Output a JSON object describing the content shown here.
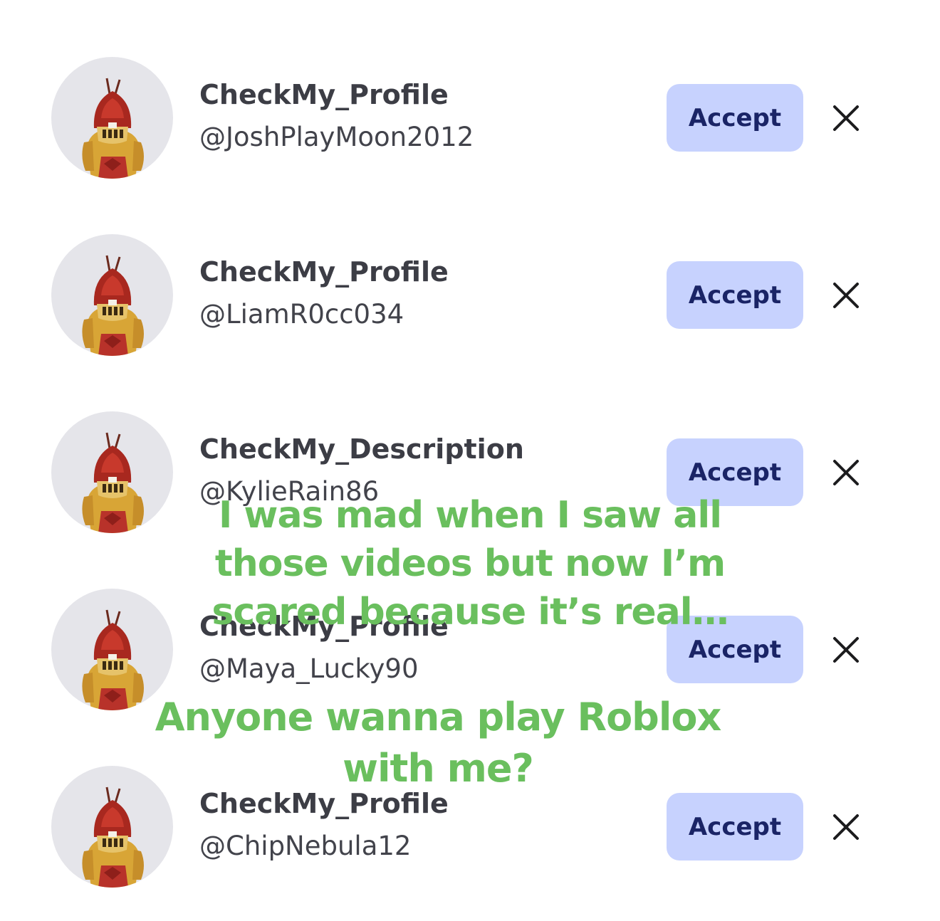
{
  "requests": [
    {
      "display_name": "CheckMy_Profile",
      "username": "@JoshPlayMoon2012",
      "accept_label": "Accept"
    },
    {
      "display_name": "CheckMy_Profile",
      "username": "@LiamR0cc034",
      "accept_label": "Accept"
    },
    {
      "display_name": "CheckMy_Description",
      "username": "@KylieRain86",
      "accept_label": "Accept"
    },
    {
      "display_name": "CheckMy_Profile",
      "username": "@Maya_Lucky90",
      "accept_label": "Accept"
    },
    {
      "display_name": "CheckMy_Profile",
      "username": "@ChipNebula12",
      "accept_label": "Accept"
    }
  ],
  "overlay_text": [
    "I was mad when I saw all those videos but now I’m scared because it’s real…",
    "Anyone wanna play Roblox with me?"
  ],
  "icons": {
    "avatar": "knight-avatar-icon",
    "decline": "close-icon"
  },
  "colors": {
    "accept_bg": "#c7d2fe",
    "accept_text": "#1a2466",
    "overlay_text": "#6abf5e",
    "avatar_bg": "#e5e5ea"
  }
}
